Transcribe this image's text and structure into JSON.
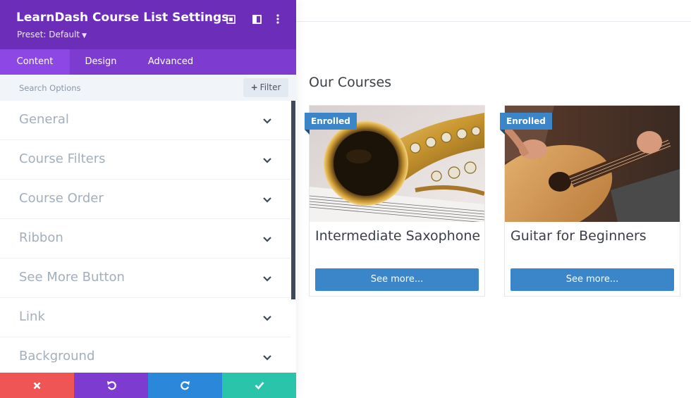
{
  "panel": {
    "title": "LearnDash Course List Settings",
    "preset": "Preset: Default",
    "header_icons": [
      "focus-icon",
      "split-view-icon",
      "more-options-icon"
    ],
    "tabs": [
      {
        "label": "Content",
        "active": true
      },
      {
        "label": "Design",
        "active": false
      },
      {
        "label": "Advanced",
        "active": false
      }
    ],
    "search": {
      "placeholder": "Search Options"
    },
    "filter_label": "Filter",
    "toggles": [
      {
        "label": "General"
      },
      {
        "label": "Course Filters"
      },
      {
        "label": "Course Order"
      },
      {
        "label": "Ribbon"
      },
      {
        "label": "See More Button"
      },
      {
        "label": "Link"
      },
      {
        "label": "Background"
      }
    ],
    "footer_buttons": [
      "discard",
      "undo",
      "redo",
      "save"
    ]
  },
  "preview": {
    "section_title": "Our Courses",
    "courses": [
      {
        "ribbon": "Enrolled",
        "title": "Intermediate Saxophone",
        "button": "See more...",
        "image": "saxophone"
      },
      {
        "ribbon": "Enrolled",
        "title": "Guitar for Beginners",
        "button": "See more...",
        "image": "guitar"
      }
    ]
  },
  "colors": {
    "header_purple": "#6c2eb9",
    "tabs_purple": "#7e3bd0",
    "active_tab": "#8c47e4",
    "accent_blue": "#3a86c8",
    "discard_red": "#ef5555",
    "redo_blue": "#2b87da",
    "save_green": "#29c4a9"
  }
}
